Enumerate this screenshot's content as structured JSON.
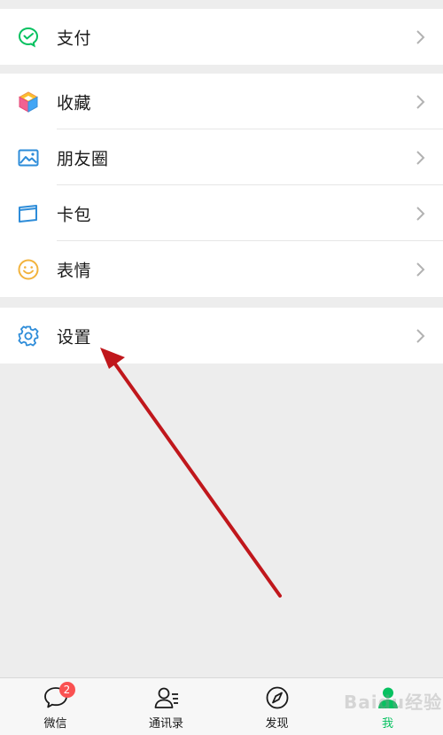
{
  "menu": {
    "pay": {
      "label": "支付",
      "icon": "wechat-pay-icon",
      "color": "#07c160"
    },
    "items": [
      {
        "label": "收藏",
        "icon": "favorites-cube-icon"
      },
      {
        "label": "朋友圈",
        "icon": "moments-picture-icon"
      },
      {
        "label": "卡包",
        "icon": "card-wallet-icon"
      },
      {
        "label": "表情",
        "icon": "sticker-smiley-icon"
      }
    ],
    "settings": {
      "label": "设置",
      "icon": "gear-icon"
    }
  },
  "annotation": {
    "color": "#c0171c",
    "target": "settings"
  },
  "tabbar": {
    "tabs": [
      {
        "label": "微信",
        "icon": "chat-bubble-icon",
        "badge": "2"
      },
      {
        "label": "通讯录",
        "icon": "contacts-icon"
      },
      {
        "label": "发现",
        "icon": "compass-icon"
      },
      {
        "label": "我",
        "icon": "me-person-icon",
        "active": true
      }
    ],
    "active_color": "#07c160",
    "badge_color": "#fa5151"
  },
  "watermark": "Baidu经验"
}
